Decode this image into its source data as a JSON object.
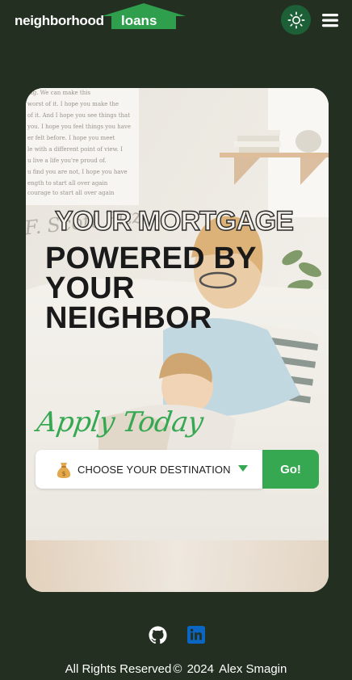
{
  "header": {
    "logo_left": "neighborhood",
    "logo_right": "loans",
    "theme_toggle_icon": "sun-icon",
    "menu_icon": "hamburger-menu-icon"
  },
  "hero": {
    "headline_outline": "YOUR MORTGAGE",
    "headline_line1": "POWERED BY",
    "headline_line2": "YOUR",
    "headline_line3": "NEIGHBOR",
    "apply_text": "Apply Today",
    "destination_icon": "money-bag-icon",
    "destination_placeholder": "CHOOSE YOUR DESTINATION",
    "go_label": "Go!"
  },
  "footer": {
    "github_icon": "github-icon",
    "linkedin_icon": "linkedin-icon",
    "rights": "All Rights Reserved",
    "copyright_symbol": "©",
    "year": "2024",
    "author": "Alex Smagin"
  },
  "colors": {
    "background": "#233021",
    "accent_green": "#36a852",
    "theme_button": "#1d5f36",
    "linkedin_blue": "#0a66c2"
  }
}
